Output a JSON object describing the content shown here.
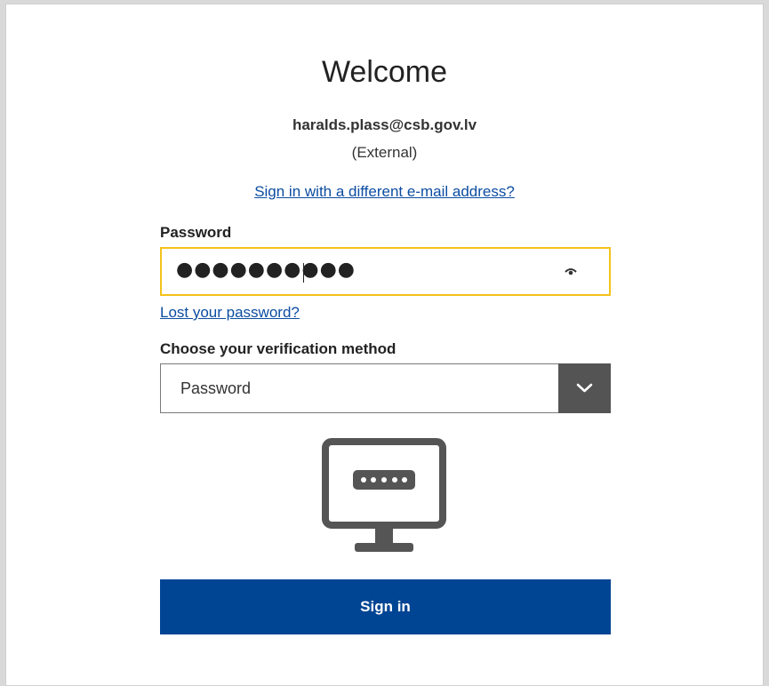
{
  "header": {
    "title": "Welcome",
    "email": "haralds.plass@csb.gov.lv",
    "account_type": "(External)",
    "switch_link": "Sign in with a different e-mail address?"
  },
  "password": {
    "label": "Password",
    "value": "●●●●●●●●●●",
    "lost_link": "Lost your password?"
  },
  "verification": {
    "label": "Choose your verification method",
    "selected": "Password"
  },
  "actions": {
    "sign_in": "Sign in"
  },
  "colors": {
    "accent": "#004494",
    "focus_border": "#f4c21a",
    "link": "#0c4da2"
  },
  "icons": {
    "show_password": "eye-icon",
    "dropdown": "chevron-down-icon",
    "method": "monitor-password-icon"
  }
}
